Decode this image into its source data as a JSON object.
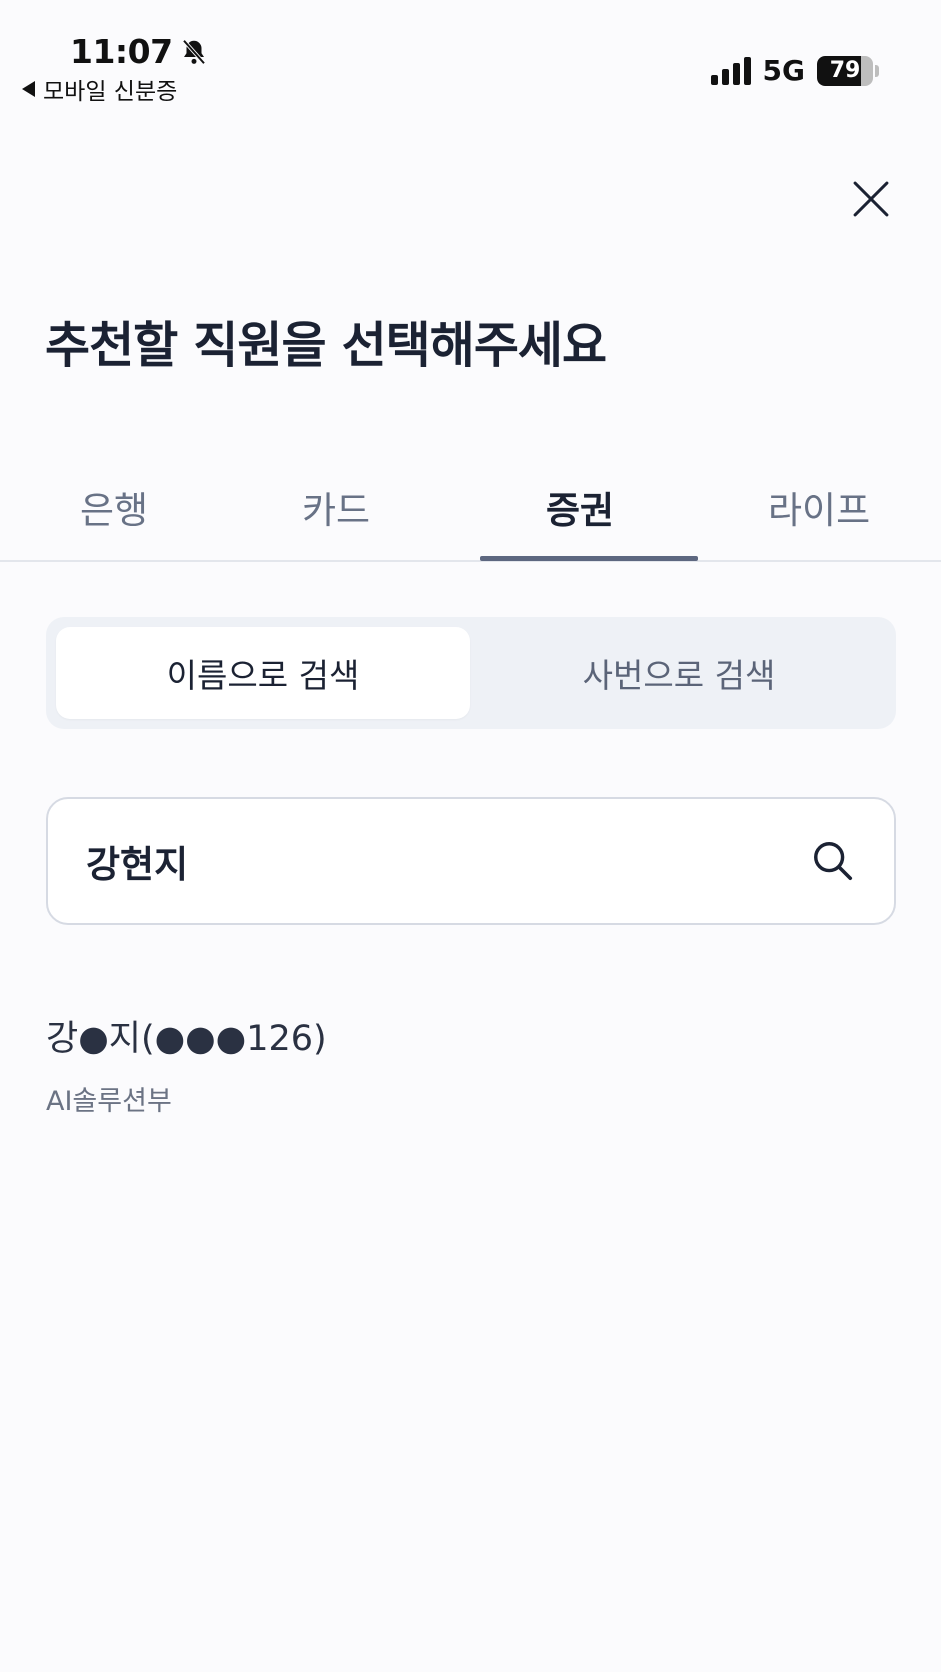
{
  "status_bar": {
    "time": "11:07",
    "back_label": "모바일 신분증",
    "network": "5G",
    "battery": "79",
    "battery_level": 0.79,
    "icons": [
      "bell-slash-icon",
      "signal-icon",
      "battery-icon"
    ]
  },
  "page": {
    "title": "추천할 직원을 선택해주세요"
  },
  "tabs": [
    {
      "label": "은행",
      "active": false
    },
    {
      "label": "카드",
      "active": false
    },
    {
      "label": "증권",
      "active": true
    },
    {
      "label": "라이프",
      "active": false
    }
  ],
  "search_mode": {
    "options": [
      {
        "label": "이름으로 검색",
        "active": true
      },
      {
        "label": "사번으로 검색",
        "active": false
      }
    ]
  },
  "search": {
    "value": "강현지"
  },
  "results": [
    {
      "name": "강●지(●●●126)",
      "department": "AI솔루션부"
    }
  ],
  "colors": {
    "background": "#fbfbfd",
    "text_primary": "#1b2233",
    "text_secondary": "#687286",
    "tab_underline": "#5d6780",
    "segment_bg": "#eef1f6"
  }
}
